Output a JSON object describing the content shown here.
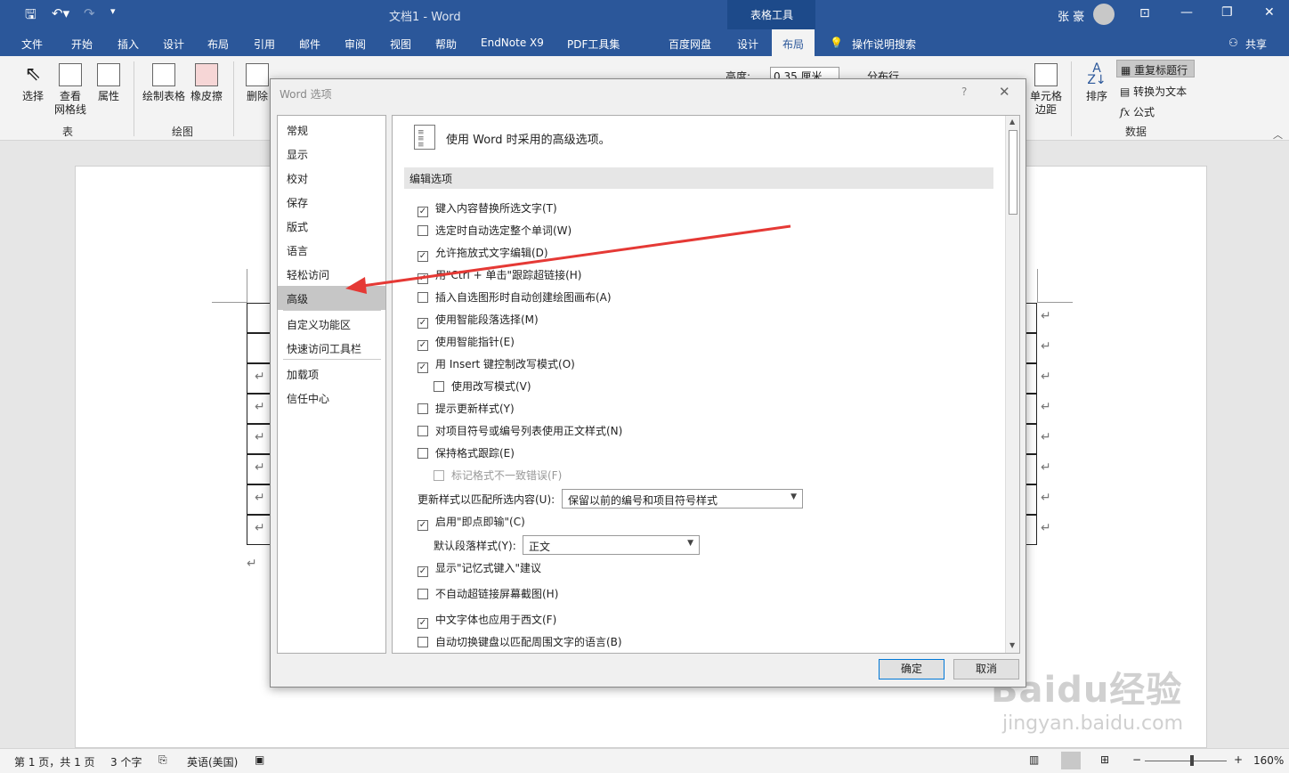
{
  "title": {
    "doc_title": "文档1 - Word",
    "context_tab": "表格工具",
    "user": "张 豪"
  },
  "tabs": [
    "文件",
    "开始",
    "插入",
    "设计",
    "布局",
    "引用",
    "邮件",
    "审阅",
    "视图",
    "帮助",
    "EndNote X9",
    "PDF工具集",
    "百度网盘",
    "设计",
    "布局"
  ],
  "tell_me": "操作说明搜索",
  "share": "共享",
  "ribbon": {
    "select": "选择",
    "view_grid": "查看",
    "view_grid2": "网格线",
    "properties": "属性",
    "draw_table": "绘制表格",
    "eraser": "橡皮擦",
    "delete": "删除",
    "height_label": "高度:",
    "height_value": "0.35 厘米",
    "distribute_rows": "分布行",
    "cell_margins": "单元格",
    "cell_margins2": "边距",
    "sort": "排序",
    "repeat_header": "重复标题行",
    "convert_text": "转换为文本",
    "formula": "公式",
    "group_table": "表",
    "group_draw": "绘图",
    "group_data": "数据"
  },
  "dialog": {
    "title": "Word 选项",
    "help": "?",
    "close": "✕",
    "nav": [
      "常规",
      "显示",
      "校对",
      "保存",
      "版式",
      "语言",
      "轻松访问",
      "高级",
      "自定义功能区",
      "快速访问工具栏",
      "加载项",
      "信任中心"
    ],
    "nav_selected": "高级",
    "header": "使用 Word 时采用的高级选项。",
    "section": "编辑选项",
    "options": [
      {
        "label": "键入内容替换所选文字(T)",
        "checked": true
      },
      {
        "label": "选定时自动选定整个单词(W)",
        "checked": false
      },
      {
        "label": "允许拖放式文字编辑(D)",
        "checked": true
      },
      {
        "label": "用\"Ctrl + 单击\"跟踪超链接(H)",
        "checked": true
      },
      {
        "label": "插入自选图形时自动创建绘图画布(A)",
        "checked": false
      },
      {
        "label": "使用智能段落选择(M)",
        "checked": true
      },
      {
        "label": "使用智能指针(E)",
        "checked": true
      },
      {
        "label": "用 Insert 键控制改写模式(O)",
        "checked": true
      },
      {
        "label": "使用改写模式(V)",
        "checked": false
      },
      {
        "label": "提示更新样式(Y)",
        "checked": false
      },
      {
        "label": "对项目符号或编号列表使用正文样式(N)",
        "checked": false
      },
      {
        "label": "保持格式跟踪(E)",
        "checked": false
      },
      {
        "label": "标记格式不一致错误(F)",
        "checked": false
      }
    ],
    "update_style_label": "更新样式以匹配所选内容(U):",
    "update_style_value": "保留以前的编号和项目符号样式",
    "click_type": {
      "label": "启用\"即点即输\"(C)",
      "checked": true
    },
    "default_para_label": "默认段落样式(Y):",
    "default_para_value": "正文",
    "options2": [
      {
        "label": "显示\"记忆式键入\"建议",
        "checked": true
      },
      {
        "label": "不自动超链接屏幕截图(H)",
        "checked": false
      },
      {
        "label": "中文字体也应用于西文(F)",
        "checked": true
      },
      {
        "label": "自动切换键盘以匹配周围文字的语言(B)",
        "checked": false
      }
    ],
    "ok": "确定",
    "cancel": "取消"
  },
  "status": {
    "page": "第 1 页，共 1 页",
    "words": "3 个字",
    "lang": "英语(美国)",
    "zoom": "160%"
  },
  "watermark": {
    "brand": "Baidu经验",
    "url": "jingyan.baidu.com"
  },
  "colors": {
    "ribbon_blue": "#2b579a",
    "arrow_red": "#e53935"
  }
}
